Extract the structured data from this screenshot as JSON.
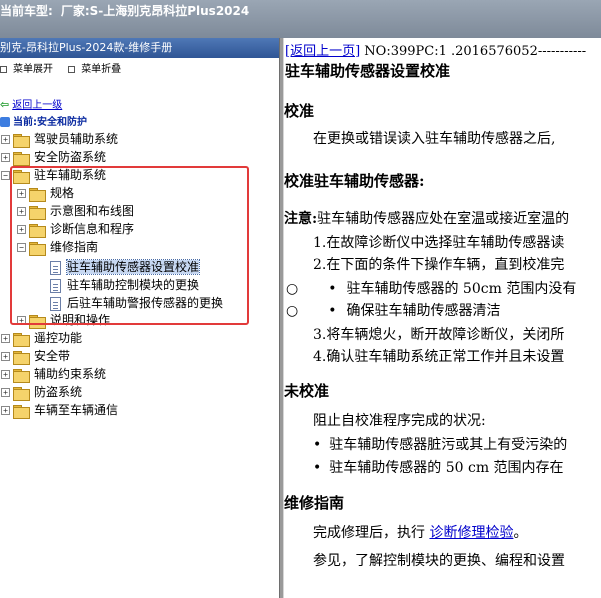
{
  "topbar": {
    "label": "当前车型:",
    "text": "厂家:S-上海别克昂科拉Plus2024"
  },
  "left": {
    "header": "别克-昂科拉Plus-2024款-维修手册",
    "expand_label": "菜单展开",
    "collapse_label": "菜单折叠",
    "back_label": "返回上一级",
    "current_label": "当前:安全和防护",
    "tree": [
      {
        "label": "驾驶员辅助系统"
      },
      {
        "label": "安全防盗系统"
      },
      {
        "label": "驻车辅助系统"
      },
      {
        "label": "规格"
      },
      {
        "label": "示意图和布线图"
      },
      {
        "label": "诊断信息和程序"
      },
      {
        "label": "维修指南"
      },
      {
        "label": "驻车辅助传感器设置校准"
      },
      {
        "label": "驻车辅助控制模块的更换"
      },
      {
        "label": "后驻车辅助警报传感器的更换"
      },
      {
        "label": "说明和操作"
      },
      {
        "label": "遥控功能"
      },
      {
        "label": "安全带"
      },
      {
        "label": "辅助约束系统"
      },
      {
        "label": "防盗系统"
      },
      {
        "label": "车辆至车辆通信"
      }
    ]
  },
  "right": {
    "back_link": "[返回上一页]",
    "doc_no": " NO:399PC:1 .2016576052-----------",
    "title": "驻车辅助传感器设置校准",
    "sections": {
      "calib_heading": "校准",
      "calib_text": "在更换或错误读入驻车辅助传感器之后,",
      "calib2_heading": "校准驻车辅助传感器:",
      "note_prefix": "注意:",
      "note_text": "驻车辅助传感器应处在室温或接近室温的",
      "step1": "1.在故障诊断仪中选择驻车辅助传感器读",
      "step2": "2.在下面的条件下操作车辆，直到校准完",
      "bullet1": "驻车辅助传感器的 50cm 范围内没有",
      "bullet2": "确保驻车辅助传感器清洁",
      "step3": "3.将车辆熄火，断开故障诊断仪，关闭所",
      "step4": "4.确认驻车辅助系统正常工作并且未设置",
      "uncal_heading": "未校准",
      "uncal_text": "阻止自校准程序完成的状况:",
      "ubullet1": "驻车辅助传感器脏污或其上有受污染的",
      "ubullet2": "驻车辅助传感器的 50 cm 范围内存在",
      "repair_heading": "维修指南",
      "repair_text_prefix": "完成修理后，执行 ",
      "repair_link": "诊断修理检验",
      "repair_text_suffix": "。",
      "see_text": "参见，了解控制模块的更换、编程和设置"
    }
  }
}
